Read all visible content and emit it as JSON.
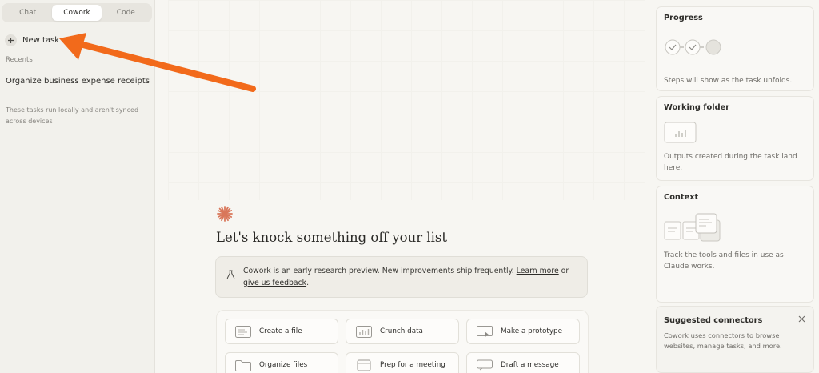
{
  "sidebar": {
    "tabs": [
      {
        "label": "Chat",
        "active": false
      },
      {
        "label": "Cowork",
        "active": true
      },
      {
        "label": "Code",
        "active": false
      }
    ],
    "new_task_label": "New task",
    "recents_label": "Recents",
    "recent_items": [
      "Organize business expense receipts"
    ],
    "local_note": "These tasks run locally and aren't synced across devices"
  },
  "main": {
    "headline": "Let's knock something off your list",
    "notice": {
      "text": "Cowork is an early research preview. New improvements ship frequently.",
      "learn_more": "Learn more",
      "or": "or",
      "feedback": "give us feedback",
      "period": "."
    },
    "actions": [
      {
        "label": "Create a file",
        "icon": "file-icon"
      },
      {
        "label": "Crunch data",
        "icon": "chart-icon"
      },
      {
        "label": "Make a prototype",
        "icon": "prototype-icon"
      },
      {
        "label": "Organize files",
        "icon": "folder-icon"
      },
      {
        "label": "Prep for a meeting",
        "icon": "calendar-icon"
      },
      {
        "label": "Draft a message",
        "icon": "message-icon"
      }
    ]
  },
  "right_panel": {
    "progress": {
      "title": "Progress",
      "body": "Steps will show as the task unfolds."
    },
    "working_folder": {
      "title": "Working folder",
      "body": "Outputs created during the task land here."
    },
    "context": {
      "title": "Context",
      "body": "Track the tools and files in use as Claude works."
    },
    "connectors": {
      "title": "Suggested connectors",
      "body": "Cowork uses connectors to browse websites, manage tasks, and more."
    }
  },
  "colors": {
    "accent": "#f26a1b",
    "star": "#d9775a",
    "background": "#f7f6f2",
    "sidebar": "#f2f1ec"
  }
}
